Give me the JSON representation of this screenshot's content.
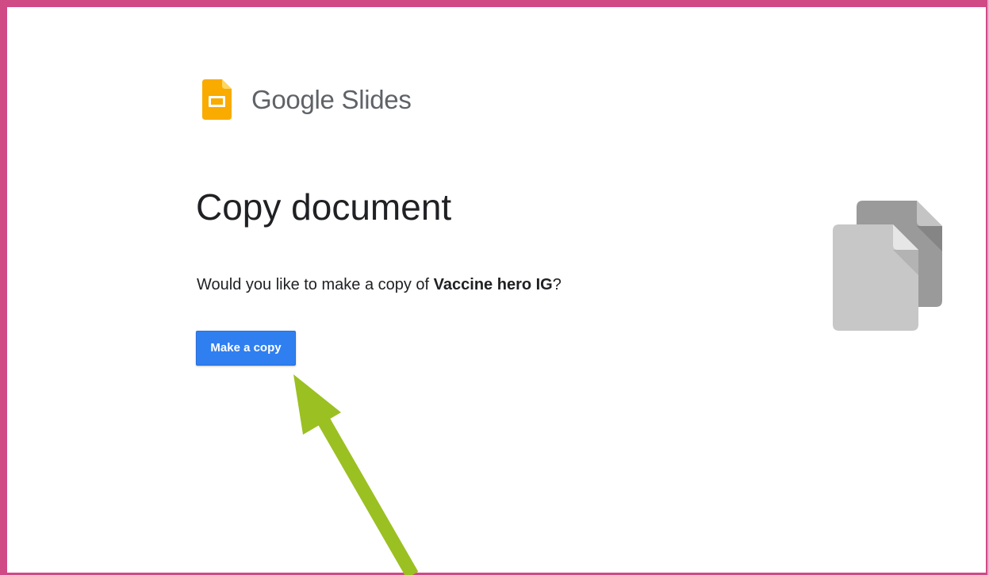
{
  "brand": {
    "name": "Google Slides",
    "logo_icon": "google-slides-logo-icon",
    "logo_color": "#f9ab00"
  },
  "page": {
    "title": "Copy document",
    "prompt_prefix": "Would you like to make a copy of ",
    "document_name": "Vaccine hero IG",
    "prompt_suffix": "?"
  },
  "actions": {
    "make_copy_label": "Make a copy"
  },
  "illustration": {
    "icon": "copy-documents-illustration"
  },
  "annotation": {
    "arrow_color": "#9bc022",
    "frame_color": "#d04a86"
  },
  "colors": {
    "primary_button": "#2f7ff0",
    "text": "#202124",
    "brand_text": "#5f6368"
  }
}
